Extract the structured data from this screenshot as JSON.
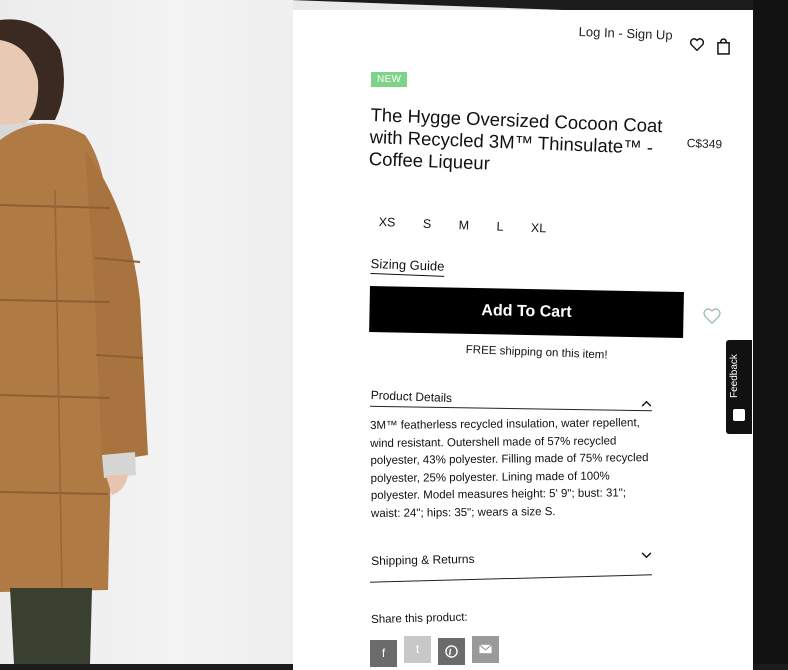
{
  "header": {
    "account_label": "Log In - Sign Up"
  },
  "product": {
    "badge": "NEW",
    "title": "The Hygge Oversized Cocoon Coat with Recycled 3M™ Thinsulate™ - Coffee Liqueur",
    "price": "C$349",
    "sizes": [
      "XS",
      "S",
      "M",
      "L",
      "XL"
    ],
    "sizing_guide": "Sizing Guide",
    "add_to_cart": "Add To Cart",
    "shipping_note": "FREE shipping on this item!"
  },
  "accordions": {
    "details_title": "Product Details",
    "details_body": "3M™ featherless recycled insulation, water repellent, wind resistant. Outershell made of 57% recycled polyester, 43% polyester. Filling made of 75% recycled polyester, 25% polyester. Lining made of 100% polyester. Model measures height: 5' 9\"; bust: 31\"; waist: 24\"; hips: 35\"; wears a size S.",
    "shipping_title": "Shipping & Returns"
  },
  "share": {
    "label": "Share this product:",
    "buttons": [
      "facebook-icon",
      "twitter-icon",
      "pinterest-icon",
      "email-icon"
    ]
  },
  "feedback": {
    "label": "Feedback"
  },
  "colors": {
    "badge": "#7ed389",
    "cart_button": "#000000",
    "coat": "#b07a45"
  }
}
